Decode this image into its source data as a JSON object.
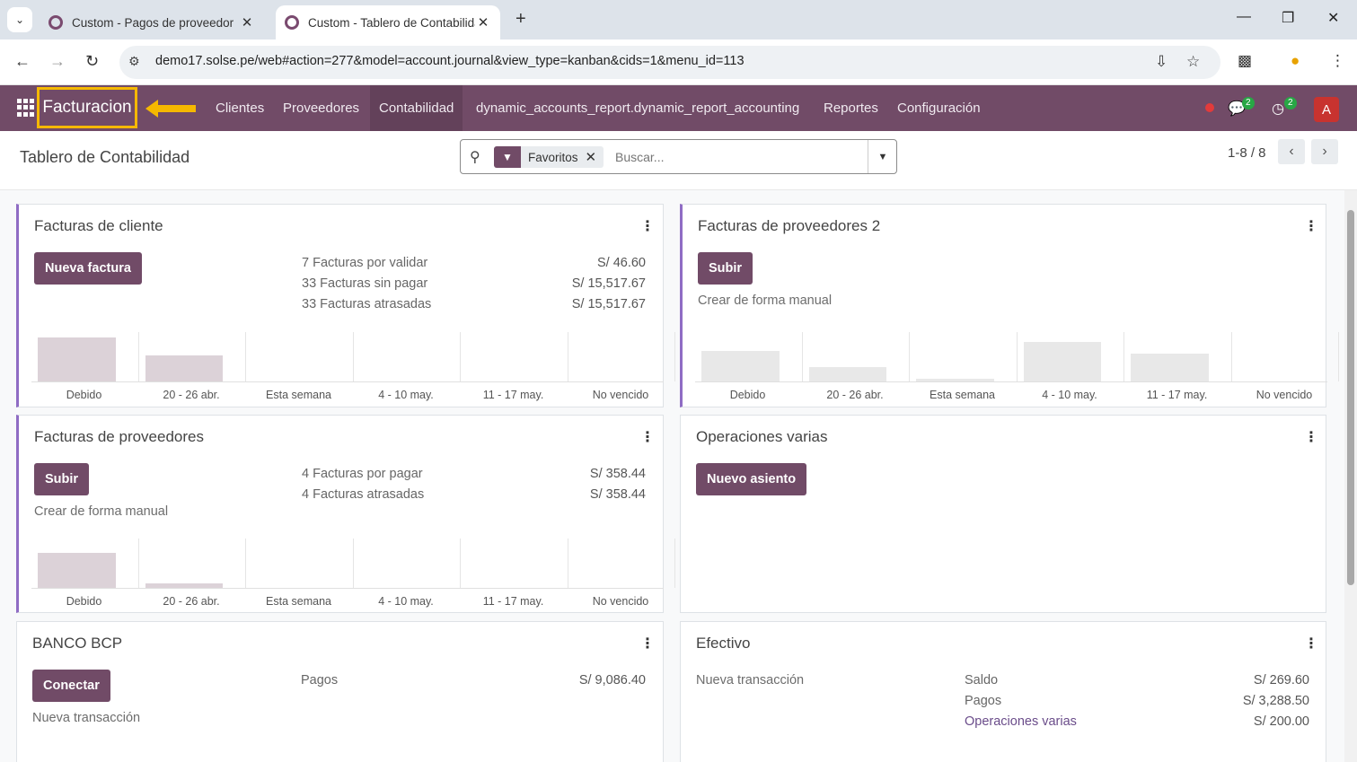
{
  "browser": {
    "tabs": [
      {
        "title": "Custom - Pagos de proveedor",
        "active": false
      },
      {
        "title": "Custom - Tablero de Contabilidad",
        "active": true
      }
    ],
    "url": "demo17.solse.pe/web#action=277&model=account.journal&view_type=kanban&cids=1&menu_id=113"
  },
  "navbar": {
    "brand": "Facturacion",
    "menu": [
      "Clientes",
      "Proveedores",
      "Contabilidad",
      "dynamic_accounts_report.dynamic_report_accounting",
      "Reportes",
      "Configuración"
    ],
    "messages_badge": "2",
    "activities_badge": "2",
    "avatar_letter": "A",
    "highlight_color": "#f5b800"
  },
  "control_panel": {
    "breadcrumb": "Tablero de Contabilidad",
    "facet_label": "Favoritos",
    "search_placeholder": "Buscar...",
    "pager": "1-8 / 8"
  },
  "graph_labels": [
    "Debido",
    "20 - 26 abr.",
    "Esta semana",
    "4 - 10 may.",
    "11 - 17 may.",
    "No vencido"
  ],
  "cards": {
    "clientes": {
      "title": "Facturas de cliente",
      "button": "Nueva factura",
      "rows": [
        {
          "label": "7 Facturas por validar",
          "amount": "S/ 46.60"
        },
        {
          "label": "33 Facturas sin pagar",
          "amount": "S/ 15,517.67"
        },
        {
          "label": "33 Facturas atrasadas",
          "amount": "S/ 15,517.67"
        }
      ],
      "bars": [
        0.95,
        0.55,
        0,
        0,
        0,
        0
      ]
    },
    "proveedores2": {
      "title": "Facturas de proveedores 2",
      "button": "Subir",
      "link": "Crear de forma manual",
      "bars": [
        0.65,
        0.3,
        0.05,
        0.85,
        0.6,
        0
      ]
    },
    "proveedores": {
      "title": "Facturas de proveedores",
      "button": "Subir",
      "link": "Crear de forma manual",
      "rows": [
        {
          "label": "4 Facturas por pagar",
          "amount": "S/ 358.44"
        },
        {
          "label": "4 Facturas atrasadas",
          "amount": "S/ 358.44"
        }
      ],
      "bars": [
        0.75,
        0.1,
        0,
        0,
        0,
        0
      ]
    },
    "varias": {
      "title": "Operaciones varias",
      "button": "Nuevo asiento"
    },
    "banco": {
      "title": "BANCO BCP",
      "button": "Conectar",
      "link": "Nueva transacción",
      "rows": [
        {
          "label": "Pagos",
          "amount": "S/ 9,086.40"
        }
      ]
    },
    "efectivo": {
      "title": "Efectivo",
      "link": "Nueva transacción",
      "rows": [
        {
          "label": "Saldo",
          "amount": "S/ 269.60"
        },
        {
          "label": "Pagos",
          "amount": "S/ 3,288.50"
        },
        {
          "label": "Operaciones varias",
          "amount": "S/ 200.00"
        }
      ]
    }
  }
}
